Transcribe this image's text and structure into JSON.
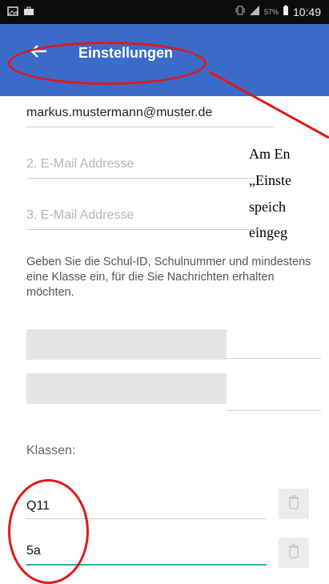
{
  "status_bar": {
    "time": "10:49",
    "battery_percent": "57%",
    "left_icons": [
      "image-icon",
      "briefcase-icon"
    ],
    "right_icons": [
      "vibrate-icon",
      "signal-icon",
      "battery-icon"
    ]
  },
  "app_bar": {
    "title": "Einstellungen",
    "back_icon": "arrow-left-icon",
    "color": "#3a6bc9"
  },
  "email": {
    "email1_value": "markus.mustermann@muster.de",
    "email2_placeholder": "2. E-Mail Addresse",
    "email3_placeholder": "3. E-Mail Addresse"
  },
  "annotation_text": {
    "line1": "Am En",
    "line2": "„Einste",
    "line3": "speich",
    "line4": "eingeg"
  },
  "hint": {
    "text": "Geben Sie die Schul-ID, Schulnummer und mindestens eine Klasse ein, für die Sie Nachrichten erhalten möchten."
  },
  "klassen": {
    "label": "Klassen:",
    "items": [
      {
        "value": "Q11",
        "delete_icon": "trash-icon"
      },
      {
        "value": "5a",
        "delete_icon": "trash-icon"
      }
    ]
  },
  "colors": {
    "accent": "#3a6bc9",
    "annotation_red": "#e01818",
    "focus_underline": "#25b3a6"
  }
}
